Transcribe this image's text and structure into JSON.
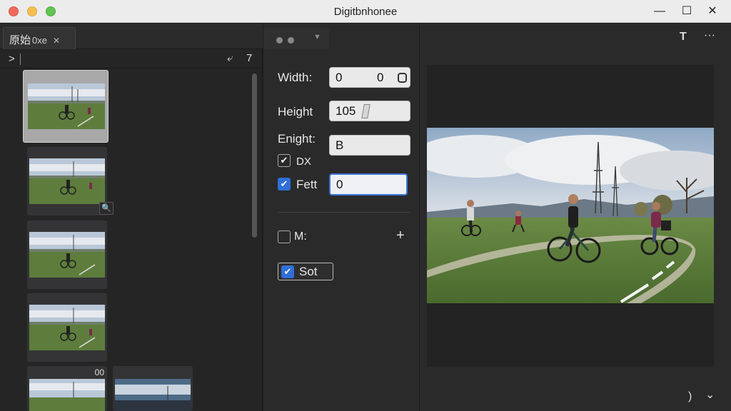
{
  "window": {
    "title": "Digitbnhonee",
    "minimize_glyph": "—",
    "maximize_glyph": "☐",
    "close_glyph": "✕"
  },
  "left_panel": {
    "tab": {
      "label": "原始",
      "sub": "0xe",
      "close_glyph": "✕"
    },
    "toolbar": {
      "expand_glyph": ">",
      "tool1_glyph": "⤶",
      "tool2_glyph": "7"
    },
    "card_label": "00",
    "zoom_glyph": "🔍"
  },
  "properties": {
    "width_label": "Width:",
    "width_value": "0",
    "width_value2": "0",
    "height_label": "Height",
    "height_value": "105",
    "enight_label": "Enight:",
    "enight_value": "B",
    "dx_label": "DX",
    "fett_label": "Fett",
    "fett_value": "0",
    "m_label": "M:",
    "add_glyph": "+",
    "sot_label": "Sot",
    "check_glyph": "✔"
  },
  "right_panel": {
    "more_glyph": "···",
    "pin_glyph": "T",
    "bottom_a": ")",
    "bottom_b": "⌄"
  },
  "colors": {
    "accent": "#2f6fd6",
    "sky": "#9db7d6",
    "grass": "#5b7a3a"
  }
}
